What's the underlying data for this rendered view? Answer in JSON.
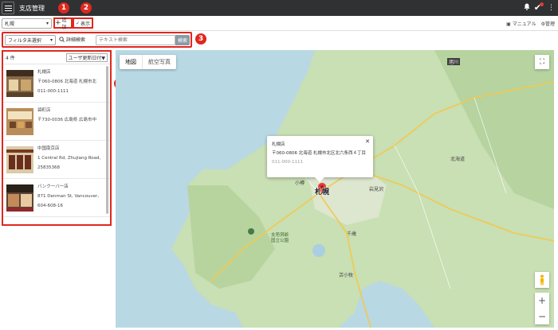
{
  "app": {
    "title": "支店管理"
  },
  "toolbar": {
    "office_select": "札幌",
    "add_label": "追加",
    "view_label": "表示",
    "manual_label": "マニュアル",
    "manage_label": "管理"
  },
  "badges": [
    "1",
    "2",
    "3",
    "4"
  ],
  "filter": {
    "filter_select": "フィルタ未選択",
    "advanced_label": "詳細検索",
    "search_placeholder": "テキスト検索",
    "search_button": "検索"
  },
  "list": {
    "count": "4 件",
    "sort_label": "ユーザ更新日付▼",
    "items": [
      {
        "name": "札幌店",
        "address": "〒060-0806 北海道 札幌市北",
        "phone": "011-000-1111"
      },
      {
        "name": "袋町店",
        "address": "〒730-0036 広島県 広島市中",
        "phone": ""
      },
      {
        "name": "中国南京店",
        "address": "1 Central Rd, Zhujiang Road,",
        "phone": "25835368"
      },
      {
        "name": "バンクーバー店",
        "address": "871 Denman St, Vancouver,",
        "phone": "604-608-16"
      }
    ]
  },
  "map": {
    "tab_map": "地図",
    "tab_aerial": "航空写真",
    "popup_name": "札幌店",
    "popup_address": "〒060-0806 北海道 札幌市北区北六条西４丁目",
    "popup_phone": "011-000-1111",
    "city_label": "札幌",
    "place_labels": [
      "旭川",
      "北海道",
      "支笏洞爺国立公園",
      "千歳",
      "小樽",
      "岩見沢",
      "苫小牧"
    ]
  },
  "colors": {
    "accent_red": "#e0281e",
    "topbar": "#2f3133",
    "sea": "#b8d8e4",
    "land": "#c9dfb4"
  }
}
